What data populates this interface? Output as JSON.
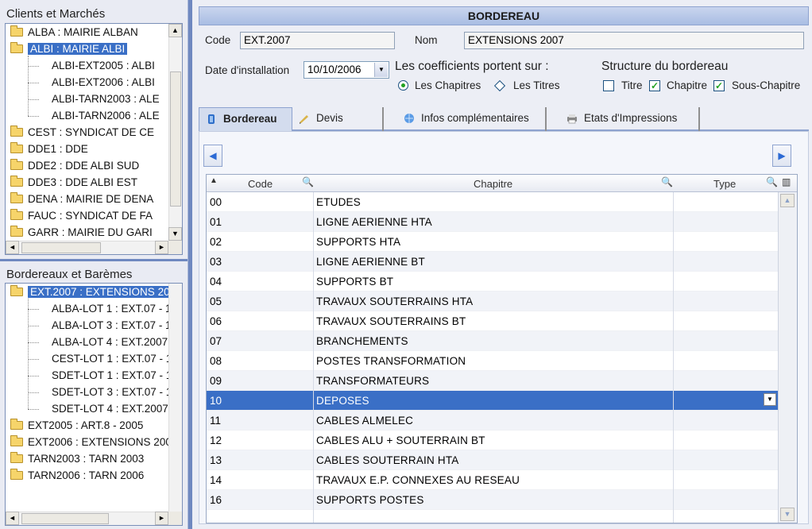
{
  "clients_panel": {
    "title": "Clients et Marchés",
    "items": [
      {
        "label": "ALBA : MAIRIE ALBAN",
        "level": 0
      },
      {
        "label": "ALBI : MAIRIE ALBI",
        "level": 0,
        "selected": true
      },
      {
        "label": "ALBI-EXT2005 : ALBI",
        "level": 1
      },
      {
        "label": "ALBI-EXT2006 : ALBI",
        "level": 1
      },
      {
        "label": "ALBI-TARN2003 : ALE",
        "level": 1
      },
      {
        "label": "ALBI-TARN2006 : ALE",
        "level": 1
      },
      {
        "label": "CEST : SYNDICAT DE CE",
        "level": 0
      },
      {
        "label": "DDE1 : DDE",
        "level": 0
      },
      {
        "label": "DDE2 : DDE ALBI SUD",
        "level": 0
      },
      {
        "label": "DDE3 : DDE ALBI EST",
        "level": 0
      },
      {
        "label": "DENA : MAIRIE DE DENA",
        "level": 0
      },
      {
        "label": "FAUC : SYNDICAT DE FA",
        "level": 0
      },
      {
        "label": "GARR : MAIRIE DU GARI",
        "level": 0
      }
    ]
  },
  "bordereaux_panel": {
    "title": "Bordereaux et Barèmes",
    "items": [
      {
        "label": "EXT.2007 : EXTENSIONS 20",
        "level": 0,
        "selected": true
      },
      {
        "label": "ALBA-LOT 1  : EXT.07 - 1",
        "level": 1
      },
      {
        "label": "ALBA-LOT 3 : EXT.07 - 1.",
        "level": 1
      },
      {
        "label": "ALBA-LOT 4 : EXT.2007 -",
        "level": 1
      },
      {
        "label": "CEST-LOT 1 : EXT.07 - 1",
        "level": 1
      },
      {
        "label": "SDET-LOT 1 : EXT.07 - 1",
        "level": 1
      },
      {
        "label": "SDET-LOT 3 : EXT.07 - 1",
        "level": 1
      },
      {
        "label": "SDET-LOT 4 : EXT.2007",
        "level": 1
      },
      {
        "label": "EXT2005 : ART.8 - 2005",
        "level": 0
      },
      {
        "label": "EXT2006 : EXTENSIONS 200",
        "level": 0
      },
      {
        "label": "TARN2003 : TARN 2003",
        "level": 0
      },
      {
        "label": "TARN2006 : TARN 2006",
        "level": 0
      }
    ]
  },
  "form": {
    "title": "BORDEREAU",
    "code_label": "Code",
    "code_value": "EXT.2007",
    "nom_label": "Nom",
    "nom_value": "EXTENSIONS 2007",
    "date_label": "Date d'installation",
    "date_value": "10/10/2006",
    "coef_heading": "Les coefficients portent sur :",
    "coef_option1": "Les Chapitres",
    "coef_option2": "Les Titres",
    "structure_heading": "Structure du bordereau",
    "struct_titre": "Titre",
    "struct_chapitre": "Chapitre",
    "struct_sous_chapitre": "Sous-Chapitre",
    "struct_titre_checked": false,
    "struct_chapitre_checked": true,
    "struct_sous_chapitre_checked": true
  },
  "tabs": [
    {
      "label": "Bordereau",
      "icon": "document-icon",
      "active": true
    },
    {
      "label": "Devis",
      "icon": "pencil-icon"
    },
    {
      "label": "Infos complémentaires",
      "icon": "globe-icon"
    },
    {
      "label": "Etats d'Impressions",
      "icon": "printer-icon"
    }
  ],
  "grid": {
    "col_code": "Code",
    "col_chapitre": "Chapitre",
    "col_type": "Type",
    "rows": [
      {
        "code": "00",
        "chapitre": "ETUDES"
      },
      {
        "code": "01",
        "chapitre": "LIGNE AERIENNE HTA"
      },
      {
        "code": "02",
        "chapitre": "SUPPORTS HTA"
      },
      {
        "code": "03",
        "chapitre": "LIGNE AERIENNE BT"
      },
      {
        "code": "04",
        "chapitre": "SUPPORTS BT"
      },
      {
        "code": "05",
        "chapitre": "TRAVAUX SOUTERRAINS HTA"
      },
      {
        "code": "06",
        "chapitre": "TRAVAUX SOUTERRAINS BT"
      },
      {
        "code": "07",
        "chapitre": "BRANCHEMENTS"
      },
      {
        "code": "08",
        "chapitre": "POSTES TRANSFORMATION"
      },
      {
        "code": "09",
        "chapitre": "TRANSFORMATEURS"
      },
      {
        "code": "10",
        "chapitre": "DEPOSES",
        "selected": true
      },
      {
        "code": "11",
        "chapitre": "CABLES ALMELEC"
      },
      {
        "code": "12",
        "chapitre": "CABLES ALU + SOUTERRAIN BT"
      },
      {
        "code": "13",
        "chapitre": "CABLES SOUTERRAIN HTA"
      },
      {
        "code": "14",
        "chapitre": "TRAVAUX E.P. CONNEXES AU RESEAU"
      },
      {
        "code": "16",
        "chapitre": "SUPPORTS POSTES"
      }
    ]
  },
  "colors": {
    "selection": "#3a6fc6",
    "panel_header": "#a9bde3",
    "check_green": "#21a121"
  }
}
